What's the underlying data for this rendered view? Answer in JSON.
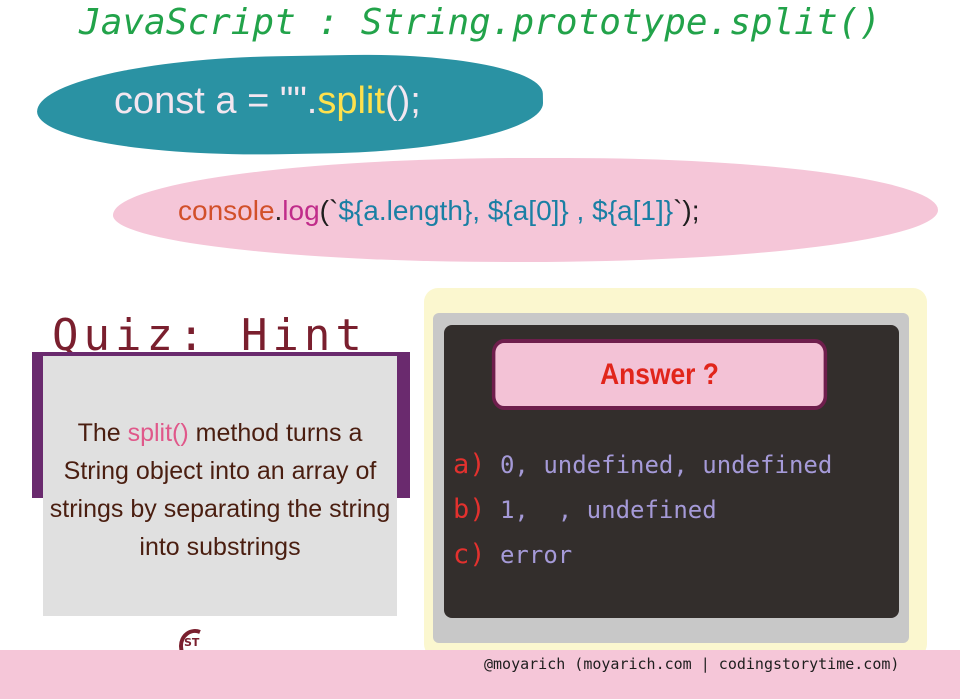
{
  "title": "JavaScript : String.prototype.split()",
  "code_line1": {
    "prefix": "const a = \"\".",
    "fn": "split",
    "suffix": "();"
  },
  "code_line2": {
    "obj": "console",
    "dot": ".",
    "fn": "log",
    "rest_open": "(`",
    "expr": "${a.length}, ${a[0]} , ${a[1]}",
    "rest_close": "`);"
  },
  "hint": {
    "title": "Quiz: Hint",
    "text_before": "The ",
    "highlight": "split()",
    "text_after": " method turns a String object into an array of strings by separating the string into substrings"
  },
  "answer": {
    "label": "Answer ?",
    "options": [
      {
        "letter": "a)",
        "value": "0, undefined, undefined"
      },
      {
        "letter": "b)",
        "value": "1,  , undefined"
      },
      {
        "letter": "c)",
        "value": "error"
      }
    ]
  },
  "footer": "@moyarich (moyarich.com | codingstorytime.com)",
  "logo_icon": "cst-logo-icon",
  "colors": {
    "title": "#22a34a",
    "teal": "#2a92a3",
    "pink": "#f5c6d8",
    "panel_dark": "#332e2c",
    "answer_red": "#e1251b"
  }
}
